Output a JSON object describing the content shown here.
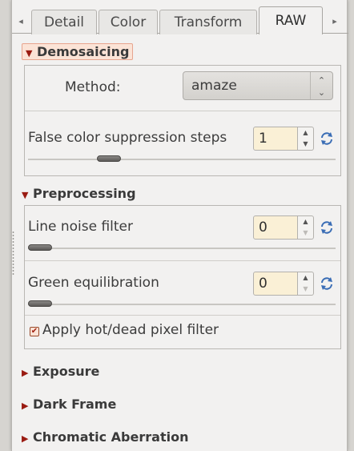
{
  "tabs": {
    "items": [
      "Detail",
      "Color",
      "Transform",
      "RAW"
    ],
    "active": "RAW",
    "left_arrow": "◂",
    "right_arrow": "▸"
  },
  "demosaicing": {
    "title": "Demosaicing",
    "method_label": "Method:",
    "method_value": "amaze",
    "false_color_label": "False color suppression steps",
    "false_color_value": "1",
    "false_color_slider": 0.27
  },
  "preprocessing": {
    "title": "Preprocessing",
    "line_noise_label": "Line noise filter",
    "line_noise_value": "0",
    "green_equil_label": "Green equilibration",
    "green_equil_value": "0",
    "hot_dead_label": "Apply hot/dead pixel filter",
    "hot_dead_checked": true
  },
  "collapsed_sections": [
    "Exposure",
    "Dark Frame",
    "Chromatic Aberration"
  ],
  "colors": {
    "accent": "#9a1b12",
    "header_highlight": "#fbe3d6",
    "input_bg": "#faf0d6",
    "reset_icon": "#3a6db5"
  },
  "icons": {
    "expanded": "expander-open-icon",
    "collapsed": "expander-closed-icon",
    "reset": "reset-refresh-icon",
    "combo": "updown-chevron-icon"
  }
}
